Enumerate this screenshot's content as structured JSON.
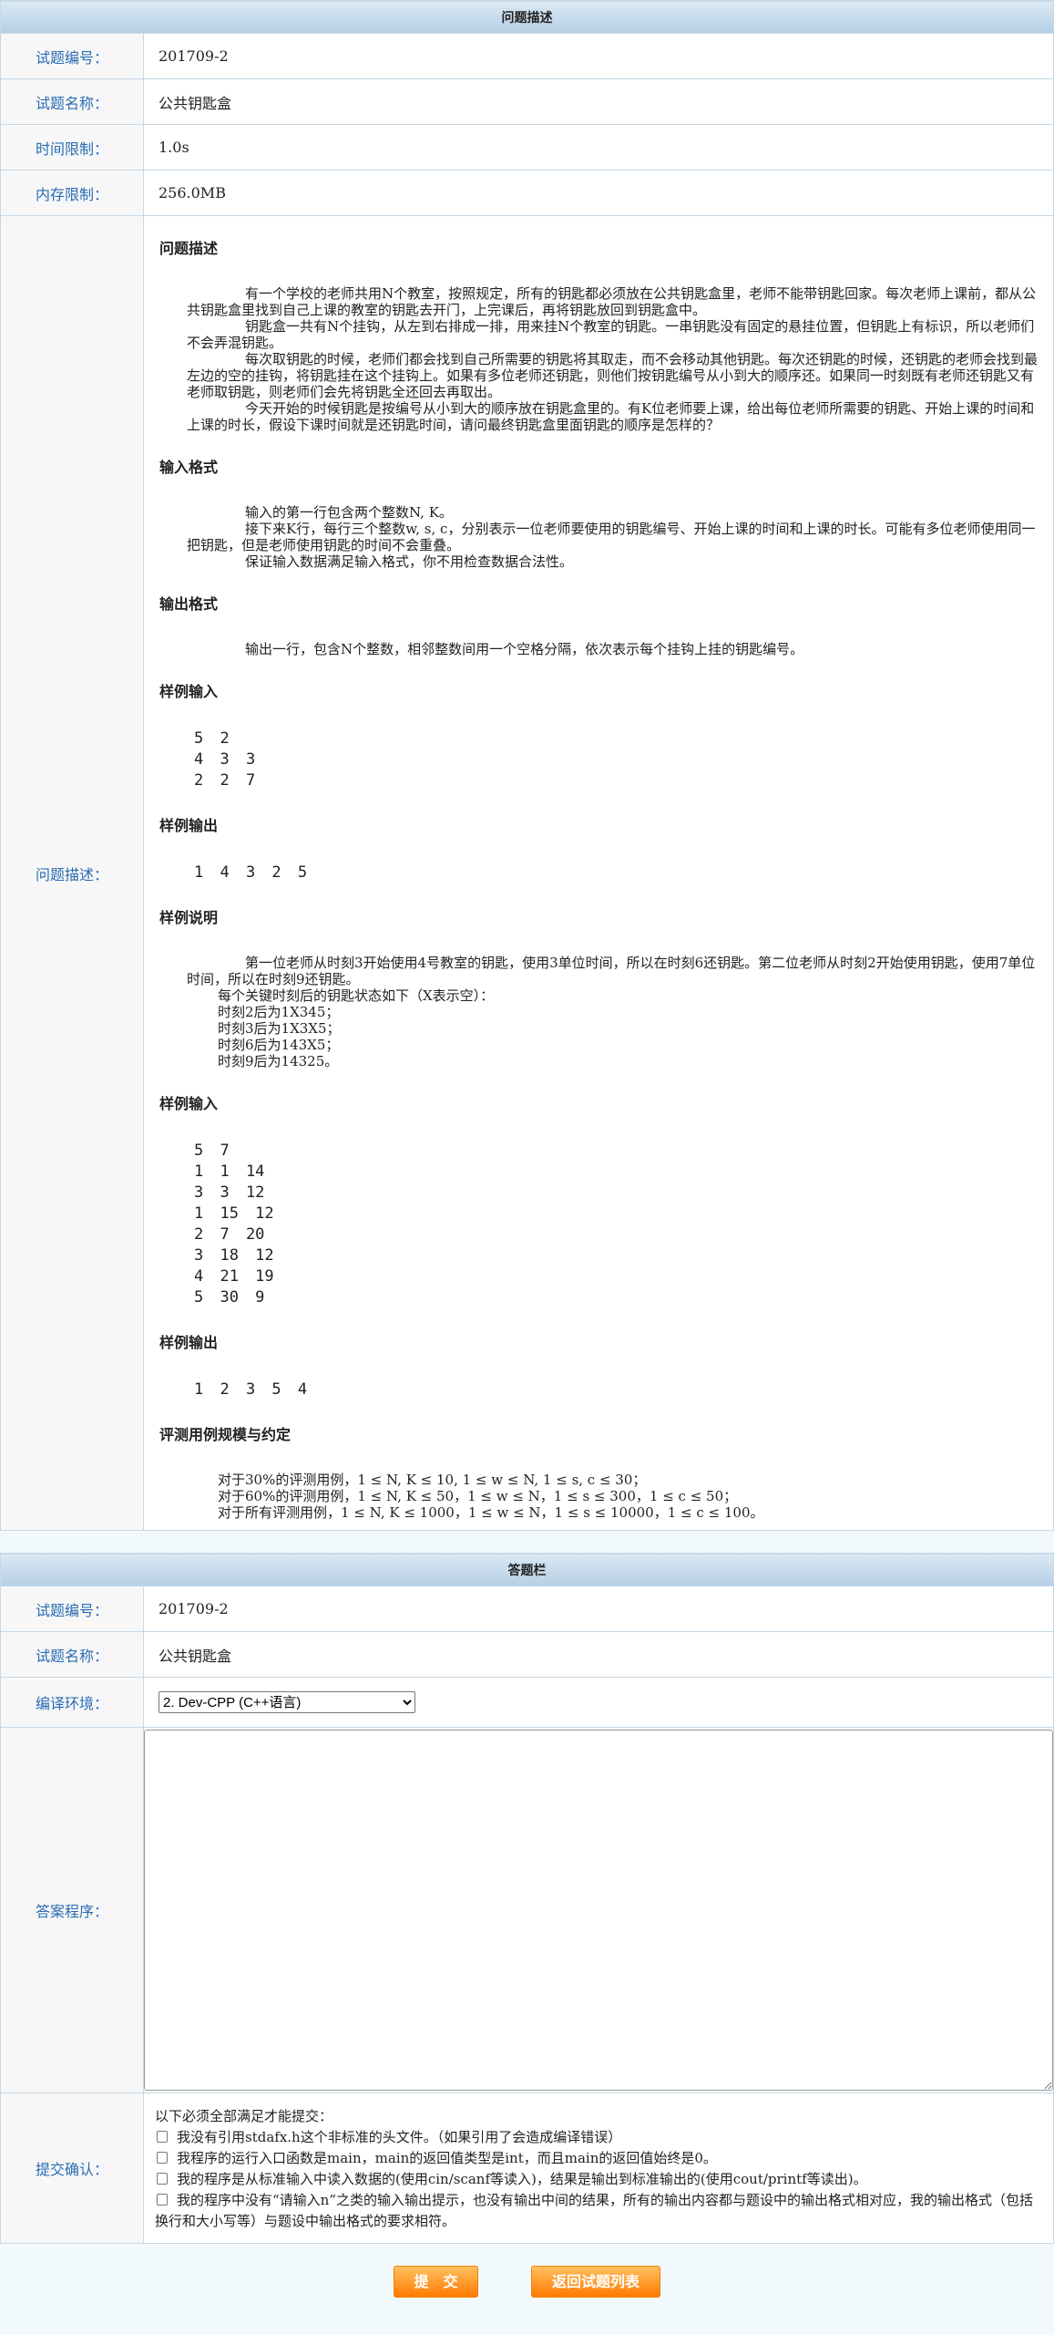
{
  "problem": {
    "header": "问题描述",
    "fields": [
      {
        "label": "试题编号：",
        "value": "201709-2"
      },
      {
        "label": "试题名称：",
        "value": "公共钥匙盒"
      },
      {
        "label": "时间限制：",
        "value": "1.0s"
      },
      {
        "label": "内存限制：",
        "value": "256.0MB"
      }
    ],
    "desc_label": "问题描述：",
    "sections": {
      "desc_title": "问题描述",
      "desc_paras": [
        "有一个学校的老师共用N个教室，按照规定，所有的钥匙都必须放在公共钥匙盒里，老师不能带钥匙回家。每次老师上课前，都从公共钥匙盒里找到自己上课的教室的钥匙去开门，上完课后，再将钥匙放回到钥匙盒中。",
        "钥匙盒一共有N个挂钩，从左到右排成一排，用来挂N个教室的钥匙。一串钥匙没有固定的悬挂位置，但钥匙上有标识，所以老师们不会弄混钥匙。",
        "每次取钥匙的时候，老师们都会找到自己所需要的钥匙将其取走，而不会移动其他钥匙。每次还钥匙的时候，还钥匙的老师会找到最左边的空的挂钩，将钥匙挂在这个挂钩上。如果有多位老师还钥匙，则他们按钥匙编号从小到大的顺序还。如果同一时刻既有老师还钥匙又有老师取钥匙，则老师们会先将钥匙全还回去再取出。",
        "今天开始的时候钥匙是按编号从小到大的顺序放在钥匙盒里的。有K位老师要上课，给出每位老师所需要的钥匙、开始上课的时间和上课的时长，假设下课时间就是还钥匙时间，请问最终钥匙盒里面钥匙的顺序是怎样的？"
      ],
      "input_title": "输入格式",
      "input_paras": [
        "输入的第一行包含两个整数N, K。",
        "接下来K行，每行三个整数w, s, c，分别表示一位老师要使用的钥匙编号、开始上课的时间和上课的时长。可能有多位老师使用同一把钥匙，但是老师使用钥匙的时间不会重叠。",
        "保证输入数据满足输入格式，你不用检查数据合法性。"
      ],
      "output_title": "输出格式",
      "output_paras": [
        "输出一行，包含N个整数，相邻整数间用一个空格分隔，依次表示每个挂钩上挂的钥匙编号。"
      ],
      "sample_in_title": "样例输入",
      "sample_in_1": "5 2\n4 3 3\n2 2 7",
      "sample_out_title": "样例输出",
      "sample_out_1": "1 4 3 2 5",
      "explain_title": "样例说明",
      "explain_para": "第一位老师从时刻3开始使用4号教室的钥匙，使用3单位时间，所以在时刻6还钥匙。第二位老师从时刻2开始使用钥匙，使用7单位时间，所以在时刻9还钥匙。",
      "explain_lines": [
        "每个关键时刻后的钥匙状态如下（X表示空）：",
        "时刻2后为1X345；",
        "时刻3后为1X3X5；",
        "时刻6后为143X5；",
        "时刻9后为14325。"
      ],
      "sample_in_2": "5 7\n1 1 14\n3 3 12\n1 15 12\n2 7 20\n3 18 12\n4 21 19\n5 30 9",
      "sample_out_2": "1 2 3 5 4",
      "scale_title": "评测用例规模与约定",
      "scale_lines": [
        "对于30%的评测用例，1 ≤ N, K ≤ 10, 1 ≤ w ≤ N, 1 ≤ s, c ≤ 30；",
        "对于60%的评测用例，1 ≤ N, K ≤ 50，1 ≤ w ≤ N，1 ≤ s ≤ 300，1 ≤ c ≤ 50；",
        "对于所有评测用例，1 ≤ N, K ≤ 1000，1 ≤ w ≤ N，1 ≤ s ≤ 10000，1 ≤ c ≤ 100。"
      ]
    }
  },
  "answer": {
    "header": "答题栏",
    "fields": [
      {
        "label": "试题编号：",
        "value": "201709-2"
      },
      {
        "label": "试题名称：",
        "value": "公共钥匙盒"
      }
    ],
    "env_label": "编译环境：",
    "env_selected": "2. Dev-CPP (C++语言)",
    "code_label": "答案程序：",
    "code_value": "",
    "confirm_label": "提交确认：",
    "confirm_intro": "以下必须全部满足才能提交：",
    "confirm_items": [
      "我没有引用stdafx.h这个非标准的头文件。（如果引用了会造成编译错误）",
      "我程序的运行入口函数是main，main的返回值类型是int，而且main的返回值始终是0。",
      "我的程序是从标准输入中读入数据的(使用cin/scanf等读入)，结果是输出到标准输出的(使用cout/printf等读出)。",
      "我的程序中没有“请输入n”之类的输入输出提示，也没有输出中间的结果，所有的输出内容都与题设中的输出格式相对应，我的输出格式（包括换行和大小写等）与题设中输出格式的要求相符。"
    ],
    "submit_label": "提　交",
    "back_label": "返回试题列表"
  }
}
